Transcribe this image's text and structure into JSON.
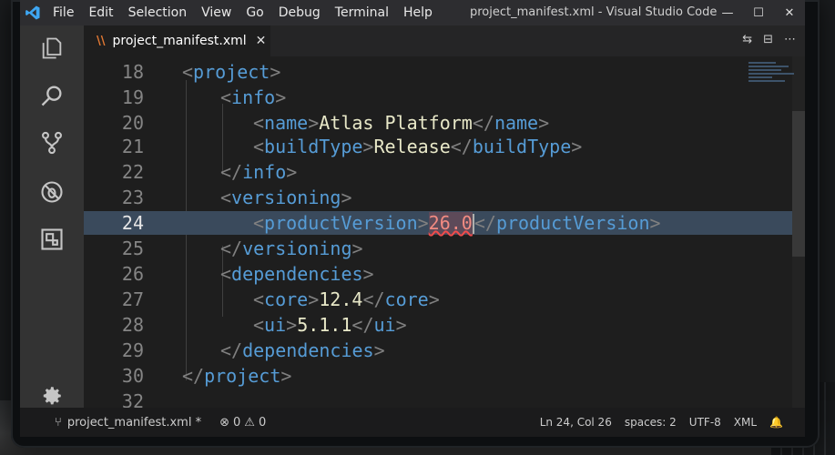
{
  "menu": [
    "File",
    "Edit",
    "Selection",
    "View",
    "Go",
    "Debug",
    "Terminal",
    "Help"
  ],
  "window": {
    "title": "project_manifest.xml - Visual Studio Code",
    "minimize": "—",
    "maximize": "☐",
    "close": "✕"
  },
  "activity_icons": [
    "explorer-icon",
    "search-icon",
    "source-control-icon",
    "debug-icon",
    "extensions-icon",
    "gear-icon"
  ],
  "tab": {
    "icon_glyph": "\\\\",
    "label": "project_manifest.xml",
    "close_glyph": "✕"
  },
  "editor_actions": [
    "⇆",
    "⊟",
    "⋯"
  ],
  "editor": {
    "current_line": "24",
    "lines": [
      {
        "n": "18",
        "t": "<project>"
      },
      {
        "n": "19",
        "t": "<info>"
      },
      {
        "n": "20",
        "t": "<name>Atlas Platform</name>"
      },
      {
        "n": "21",
        "t": "<buildType>Release</buildType>"
      },
      {
        "n": "22",
        "t": "</info>"
      },
      {
        "n": "23",
        "t": "<versioning>"
      },
      {
        "n": "24",
        "t": "<productVersion>26.0</productVersion>"
      },
      {
        "n": "25",
        "t": "</versioning>"
      },
      {
        "n": "26",
        "t": "<dependencies>"
      },
      {
        "n": "27",
        "t": "<core>12.4</core>"
      },
      {
        "n": "28",
        "t": "<ui>5.1.1</ui>"
      },
      {
        "n": "29",
        "t": "</dependencies>"
      },
      {
        "n": "30",
        "t": "</project>"
      },
      {
        "n": "32",
        "t": ""
      }
    ]
  },
  "status": {
    "branch": "project_manifest.xml *",
    "errors": "0",
    "warnings": "0",
    "position": "Ln 24, Col 26",
    "spaces": "spaces: 2",
    "encoding": "UTF-8",
    "language": "XML"
  },
  "colors": {
    "tag": "#569cd6",
    "text": "#e8e8c8",
    "line_highlight": "#3a4a5c",
    "error_squiggle": "#f14c4c"
  }
}
